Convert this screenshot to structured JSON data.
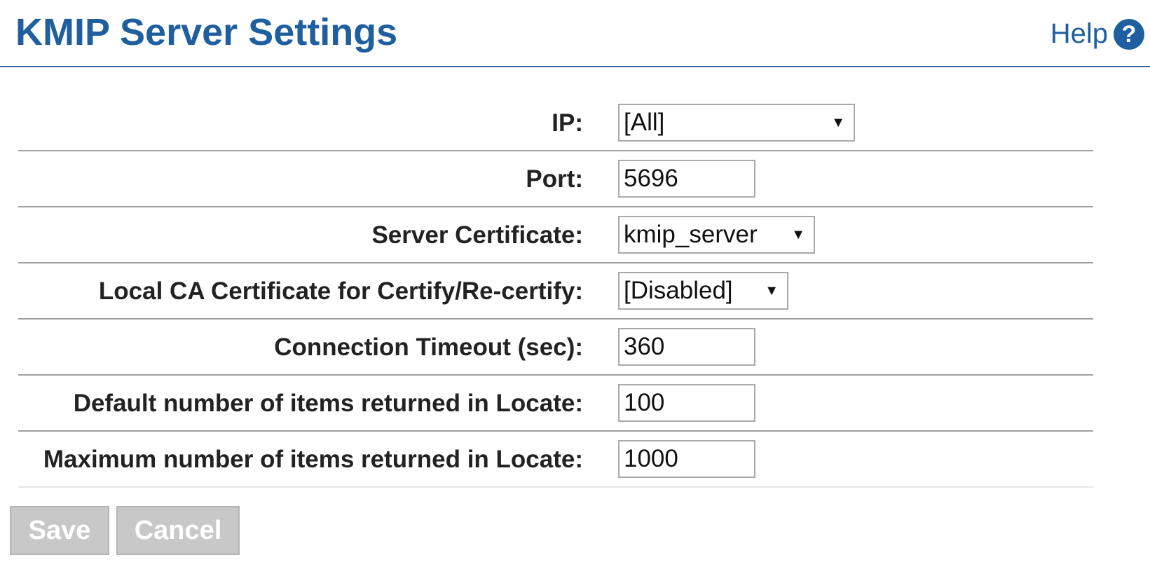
{
  "header": {
    "title": "KMIP Server Settings",
    "help_label": "Help",
    "help_icon": "question-circle-icon",
    "accent_color": "#1f5fa0"
  },
  "form": {
    "ip": {
      "label": "IP:",
      "value": "[All]"
    },
    "port": {
      "label": "Port:",
      "value": "5696"
    },
    "server_certificate": {
      "label": "Server Certificate:",
      "value": "kmip_server"
    },
    "local_ca": {
      "label": "Local CA Certificate for Certify/Re-certify:",
      "value": "[Disabled]"
    },
    "timeout": {
      "label": "Connection Timeout (sec):",
      "value": "360"
    },
    "default_items": {
      "label": "Default number of items returned in Locate:",
      "value": "100"
    },
    "max_items": {
      "label": "Maximum number of items returned in Locate:",
      "value": "1000"
    }
  },
  "buttons": {
    "save": "Save",
    "cancel": "Cancel"
  }
}
